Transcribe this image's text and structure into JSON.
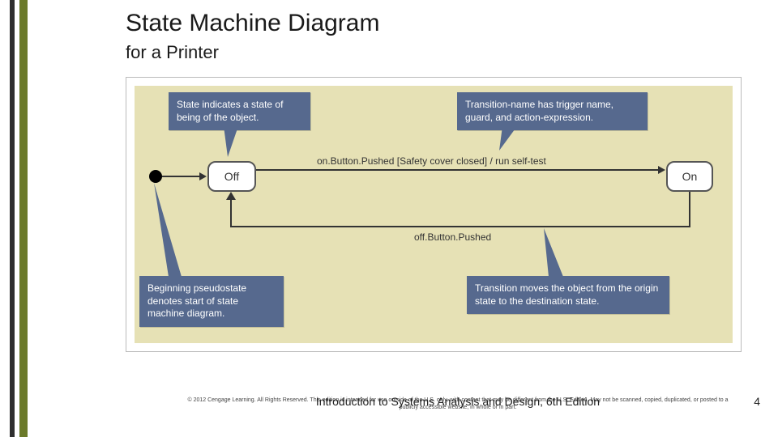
{
  "title": "State Machine Diagram",
  "subtitle": "for a Printer",
  "callouts": {
    "state": "State indicates a state of being of the object.",
    "transitionName": "Transition-name has trigger name, guard, and action-expression.",
    "pseudostate": "Beginning pseudostate denotes start of state machine diagram.",
    "transitionMove": "Transition moves the object from the origin state to the destination state."
  },
  "states": {
    "off": "Off",
    "on": "On"
  },
  "transitions": {
    "on": "on.Button.Pushed [Safety cover closed] / run self-test",
    "off": "off.Button.Pushed"
  },
  "footer": {
    "copyright": "© 2012 Cengage Learning. All Rights Reserved. This edition is intended for use outside of the U.S. only, with content that may be different from the U.S. Edition. May not be scanned, copied, duplicated, or posted to a publicly accessible website, in whole or in part.",
    "book": "Introduction to Systems Analysis and Design, 6th Edition",
    "page": "4"
  },
  "chart_data": {
    "type": "table",
    "diagram": "UML State Machine",
    "subject": "Printer",
    "initial_pseudostate": true,
    "states": [
      "Off",
      "On"
    ],
    "transitions": [
      {
        "from": "initial",
        "to": "Off",
        "label": ""
      },
      {
        "from": "Off",
        "to": "On",
        "trigger": "on.Button.Pushed",
        "guard": "Safety cover closed",
        "action": "run self-test"
      },
      {
        "from": "On",
        "to": "Off",
        "trigger": "off.Button.Pushed"
      }
    ],
    "annotations": [
      "State indicates a state of being of the object.",
      "Transition-name has trigger name, guard, and action-expression.",
      "Beginning pseudostate denotes start of state machine diagram.",
      "Transition moves the object from the origin state to the destination state."
    ]
  }
}
